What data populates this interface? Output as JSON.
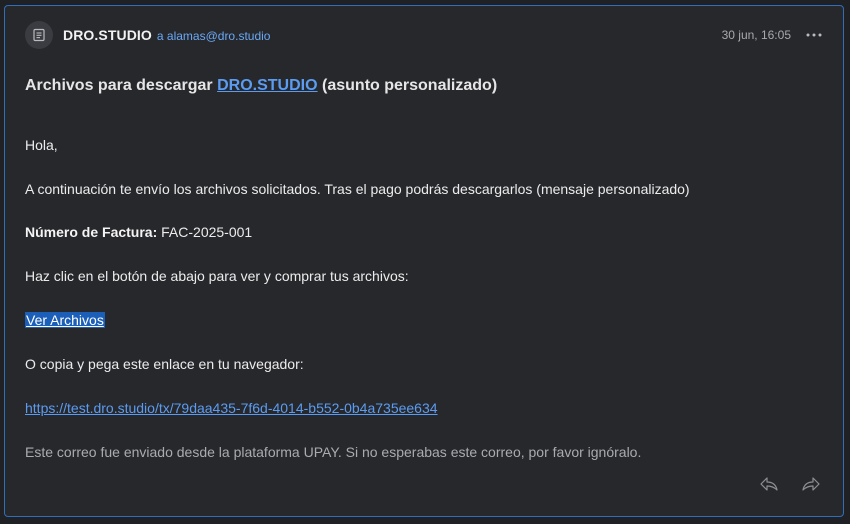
{
  "header": {
    "sender": "DRO.STUDIO",
    "recipient": "a alamas@dro.studio",
    "date": "30 jun, 16:05",
    "avatar_icon": "document-icon",
    "more_icon": "more-horizontal-icon"
  },
  "subject": {
    "prefix": "Archivos para descargar",
    "link": "DRO.STUDIO",
    "suffix": "(asunto personalizado)"
  },
  "body": {
    "greeting": "Hola,",
    "intro": "A continuación te envío los archivos solicitados. Tras el pago podrás descargarlos (mensaje personalizado)",
    "invoice_label": "Número de Factura:",
    "invoice_value": "FAC-2025-001",
    "instruction": "Haz clic en el botón de abajo para ver y comprar tus archivos:",
    "view_link": "Ver Archivos",
    "copy_prompt": "O copia y pega este enlace en tu navegador:",
    "url": "https://test.dro.studio/tx/79daa435-7f6d-4014-b552-0b4a735ee634",
    "footer_note": "Este correo fue enviado desde la plataforma UPAY. Si no esperabas este correo, por favor ignóralo."
  },
  "actions": {
    "reply_icon": "reply-icon",
    "forward_icon": "forward-icon"
  },
  "colors": {
    "background": "#27282c",
    "accent_link": "#5b9cf2",
    "selection": "#1c5fb8",
    "border": "#2f6fba"
  }
}
